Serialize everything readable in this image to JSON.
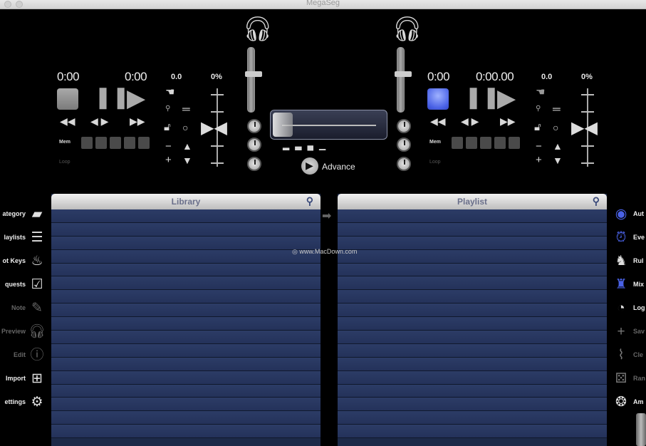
{
  "window": {
    "title": "MegaSeg"
  },
  "deck_left": {
    "time_elapsed": "0:00",
    "time_remaining": "0:00",
    "pitch_value": "0.0",
    "pitch_percent": "0%",
    "mem_label": "Mem",
    "loop_label": "Loop"
  },
  "deck_right": {
    "time_elapsed": "0:00",
    "time_remaining": "0:00.00",
    "pitch_value": "0.0",
    "pitch_percent": "0%",
    "mem_label": "Mem",
    "loop_label": "Loop"
  },
  "crossfader": {
    "advance_label": "Advance"
  },
  "library": {
    "header": "Library"
  },
  "playlist": {
    "header": "Playlist"
  },
  "watermark": "www.MacDown.com",
  "left_sidebar": [
    {
      "label": "ategory",
      "icon": "folder-icon",
      "enabled": true
    },
    {
      "label": "laylists",
      "icon": "list-icon",
      "enabled": true
    },
    {
      "label": "ot Keys",
      "icon": "flame-icon",
      "enabled": true
    },
    {
      "label": "quests",
      "icon": "clipboard-icon",
      "enabled": true
    },
    {
      "label": "Note",
      "icon": "pencil-icon",
      "enabled": false
    },
    {
      "label": "Preview",
      "icon": "headphones-icon",
      "enabled": false
    },
    {
      "label": "Edit",
      "icon": "info-icon",
      "enabled": false
    },
    {
      "label": "Import",
      "icon": "add-folder-icon",
      "enabled": true
    },
    {
      "label": "ettings",
      "icon": "gear-icon",
      "enabled": true
    }
  ],
  "right_sidebar": [
    {
      "label": "Aut",
      "icon": "automation-icon",
      "enabled": true
    },
    {
      "label": "Eve",
      "icon": "alarm-clock-icon",
      "enabled": true
    },
    {
      "label": "Rul",
      "icon": "rules-icon",
      "enabled": true
    },
    {
      "label": "Mix",
      "icon": "mixer-icon",
      "enabled": true
    },
    {
      "label": "Log",
      "icon": "log-icon",
      "enabled": true
    },
    {
      "label": "Sav",
      "icon": "plus-icon",
      "enabled": false
    },
    {
      "label": "Cle",
      "icon": "broom-icon",
      "enabled": false
    },
    {
      "label": "Ran",
      "icon": "dice-icon",
      "enabled": false
    },
    {
      "label": "Am",
      "icon": "ambience-icon",
      "enabled": true
    }
  ],
  "colors": {
    "accent_blue": "#4a62e6",
    "row_blue": "#2c3c66",
    "panel_header": "#d8d8d8"
  }
}
